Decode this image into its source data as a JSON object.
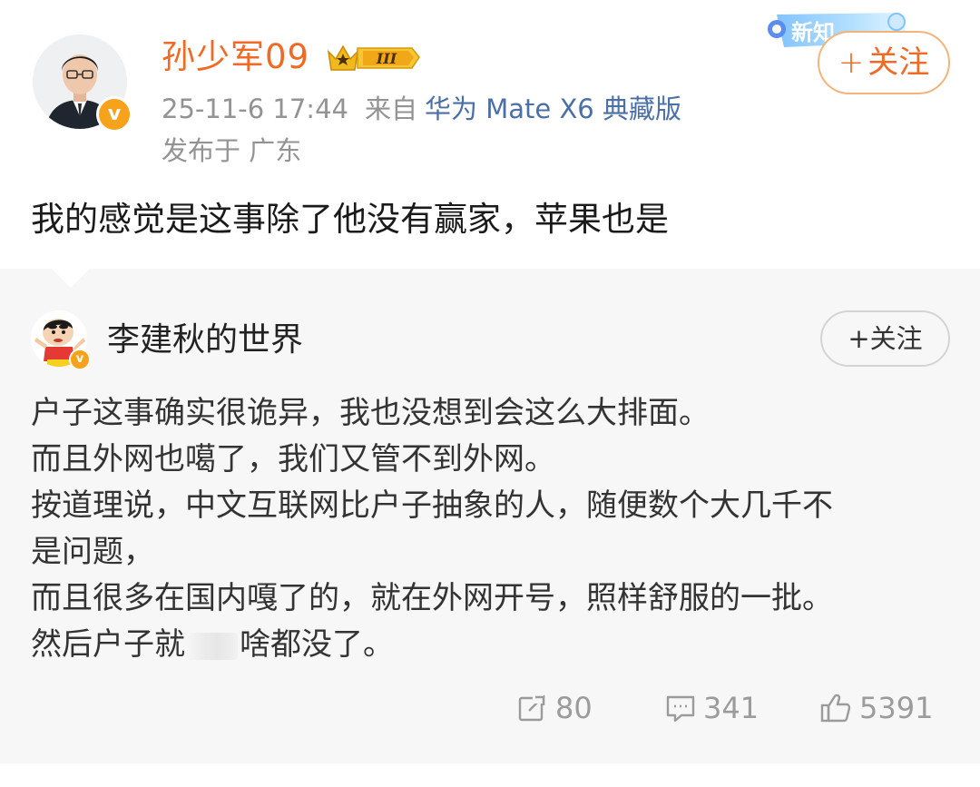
{
  "post": {
    "author_name": "孙少军09",
    "level_badge": "III",
    "time": "25-11-6 17:44",
    "source_label": "来自",
    "device": "华为 Mate X6 典藏版",
    "region": "发布于 广东",
    "promo_text": "新知",
    "follow_label": "关注",
    "follow_plus": "+",
    "verified_mark": "v",
    "text": "我的感觉是这事除了他没有赢家，苹果也是"
  },
  "quoted": {
    "author_name": "李建秋的世界",
    "verified_mark": "v",
    "follow_label": "+关注",
    "lines": [
      "户子这事确实很诡异，我也没想到会这么大排面。",
      "而且外网也噶了，我们又管不到外网。",
      "按道理说，中文互联网比户子抽象的人，随便数个大几千不",
      "是问题，",
      "而且很多在国内嘎了的，就在外网开号，照样舒服的一批。"
    ],
    "last_line_before": "然后户子就",
    "last_line_after": "啥都没了。",
    "actions": {
      "reposts": "80",
      "comments": "341",
      "likes": "5391"
    }
  },
  "colors": {
    "author_orange": "#f06a26",
    "device_blue": "#4b6fa7",
    "meta_gray": "#939393",
    "verified_gold": "#f7a21b",
    "quoted_bg": "#f7f7f7"
  },
  "icons": [
    "repost-icon",
    "comment-icon",
    "like-icon",
    "verified-badge-icon",
    "level-crown-icon"
  ]
}
